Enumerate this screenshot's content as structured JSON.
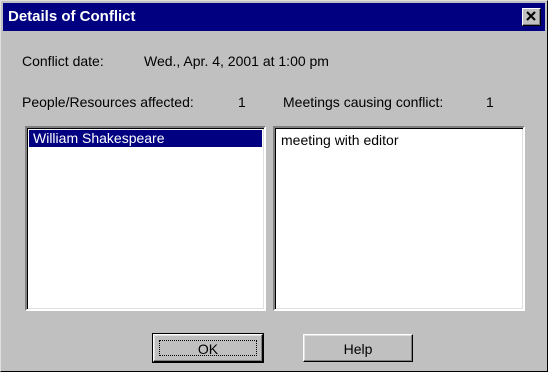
{
  "window": {
    "title": "Details of Conflict"
  },
  "conflict": {
    "date_label": "Conflict date:",
    "date_value": "Wed., Apr. 4, 2001 at 1:00 pm",
    "people_label": "People/Resources affected:",
    "people_count": "1",
    "meetings_label": "Meetings causing conflict:",
    "meetings_count": "1"
  },
  "people_list": {
    "items": [
      {
        "label": "William Shakespeare",
        "selected": true
      }
    ]
  },
  "meetings_list": {
    "items": [
      {
        "label": "meeting with editor",
        "selected": false
      }
    ]
  },
  "buttons": {
    "ok_label": "OK",
    "help_label": "Help"
  },
  "icons": {
    "close": "close-icon"
  },
  "colors": {
    "titlebar": "#000080",
    "dialog_face": "#c0c0c0",
    "selection": "#000080"
  }
}
